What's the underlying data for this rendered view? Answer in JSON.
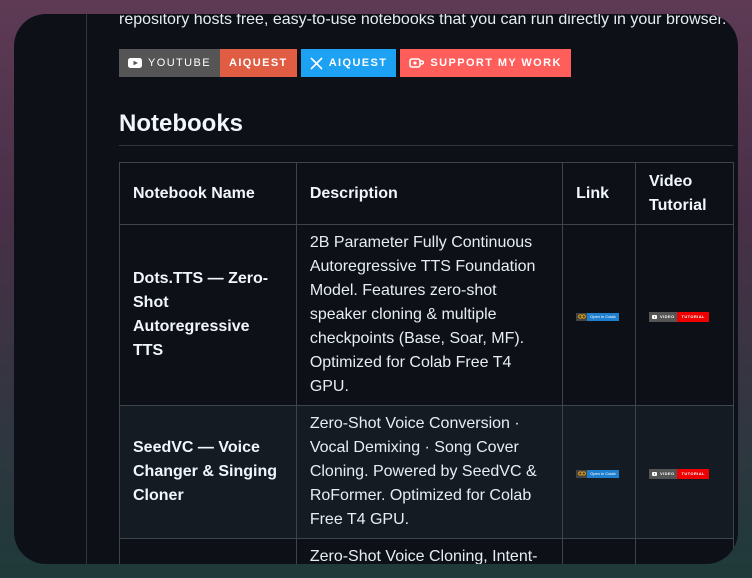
{
  "intro_text": "repository hosts free, easy-to-use notebooks that you can run directly in your browser.",
  "badges": {
    "youtube": {
      "left": "YOUTUBE",
      "right": "AIQUEST"
    },
    "x": {
      "label": "AIQUEST"
    },
    "support": {
      "label": "SUPPORT MY WORK"
    }
  },
  "section_heading": "Notebooks",
  "table": {
    "headers": {
      "name": "Notebook Name",
      "description": "Description",
      "link": "Link",
      "video": "Video Tutorial"
    },
    "rows": [
      {
        "name": "Dots.TTS — Zero-Shot Autoregressive TTS",
        "description": "2B Parameter Fully Continuous Autoregressive TTS Foundation Model. Features zero-shot speaker cloning & multiple checkpoints (Base, Soar, MF). Optimized for Colab Free T4 GPU.",
        "colab_label": "Open in Colab",
        "video_left": "VIDEO",
        "video_right": "TUTORIAL"
      },
      {
        "name": "SeedVC — Voice Changer & Singing Cloner",
        "description": "Zero-Shot Voice Conversion · Vocal Demixing · Song Cover Cloning. Powered by SeedVC & RoFormer. Optimized for Colab Free T4 GPU.",
        "colab_label": "Open in Colab",
        "video_left": "VIDEO",
        "video_right": "TUTORIAL"
      },
      {
        "name": "",
        "description": "Zero-Shot Voice Cloning, Intent-",
        "colab_label": "",
        "video_left": "",
        "video_right": ""
      }
    ]
  },
  "colors": {
    "background": "#0d1117",
    "border": "#3d444d",
    "aiquest_red": "#e05d44",
    "x_blue": "#1da1f2",
    "kofi": "#ff5e5b"
  }
}
